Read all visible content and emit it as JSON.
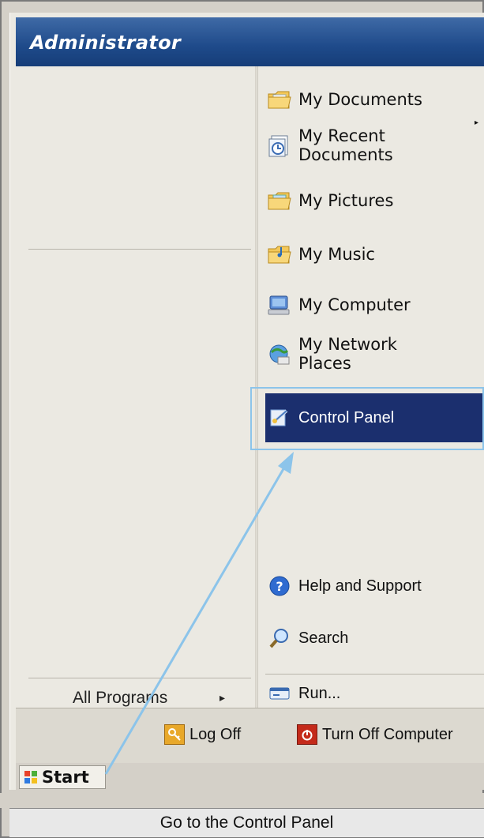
{
  "header": {
    "user_name": "Administrator"
  },
  "left_column": {
    "all_programs_label": "All Programs",
    "all_programs_arrow": "▸"
  },
  "right_column": {
    "items": [
      {
        "label": "My Documents",
        "icon": "folder-documents-icon"
      },
      {
        "label": "My Recent Documents",
        "label_line1": "My Recent",
        "label_line2": "Documents",
        "icon": "recent-documents-icon",
        "has_submenu": true
      },
      {
        "label": "My Pictures",
        "icon": "folder-pictures-icon"
      },
      {
        "label": "My Music",
        "icon": "folder-music-icon"
      },
      {
        "label": "My Computer",
        "icon": "computer-icon"
      },
      {
        "label": "My Network Places",
        "label_line1": "My Network",
        "label_line2": "Places",
        "icon": "network-places-icon"
      },
      {
        "label": "Control Panel",
        "icon": "control-panel-icon",
        "highlighted": true
      },
      {
        "label": "Help and Support",
        "icon": "help-icon"
      },
      {
        "label": "Search",
        "icon": "search-icon"
      },
      {
        "label": "Run...",
        "icon": "run-icon"
      }
    ],
    "submenu_arrow": "▸"
  },
  "footer": {
    "log_off_label": "Log Off",
    "turn_off_label": "Turn Off Computer"
  },
  "taskbar": {
    "start_label": "Start"
  },
  "caption": {
    "text": "Go to the Control Panel"
  },
  "colors": {
    "header": "#1e4a8a",
    "highlight": "#1b2f6e",
    "annotation": "#8cc4ea",
    "menu_bg": "#ebe9e2"
  }
}
